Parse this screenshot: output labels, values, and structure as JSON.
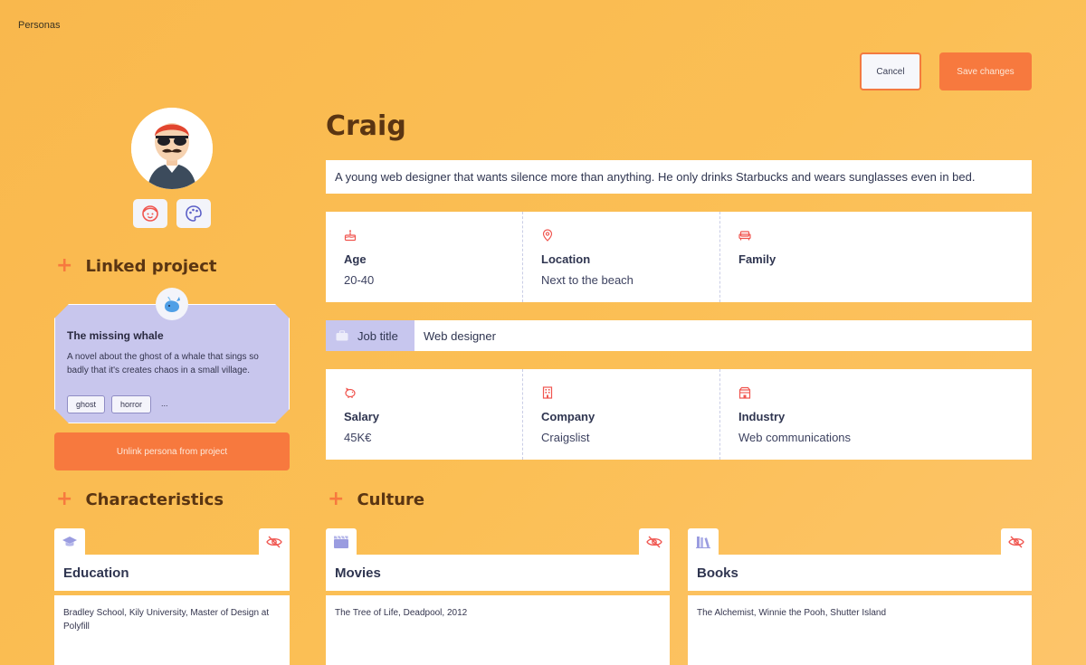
{
  "breadcrumb": "Personas",
  "actions": {
    "cancel": "Cancel",
    "save": "Save changes"
  },
  "persona": {
    "name": "Craig",
    "description": "A young web designer that wants silence more than anything. He only drinks Starbucks and wears sunglasses even in bed."
  },
  "linked_project": {
    "heading": "Linked project",
    "title": "The missing whale",
    "description": "A novel about the ghost of a whale that sings so badly that it's creates chaos in a small village.",
    "tags": [
      "ghost",
      "horror"
    ],
    "more": "...",
    "unlink_label": "Unlink persona from project"
  },
  "info_row_1": [
    {
      "icon": "cake-icon",
      "label": "Age",
      "value": "20-40"
    },
    {
      "icon": "location-pin-icon",
      "label": "Location",
      "value": "Next to the beach"
    },
    {
      "icon": "sofa-icon",
      "label": "Family",
      "value": ""
    }
  ],
  "job": {
    "label": "Job title",
    "value": "Web designer"
  },
  "info_row_2": [
    {
      "icon": "piggy-bank-icon",
      "label": "Salary",
      "value": "45K€"
    },
    {
      "icon": "building-icon",
      "label": "Company",
      "value": "Craigslist"
    },
    {
      "icon": "factory-icon",
      "label": "Industry",
      "value": "Web communications"
    }
  ],
  "characteristics": {
    "heading": "Characteristics",
    "cards": [
      {
        "icon": "graduation-cap-icon",
        "title": "Education",
        "body": "Bradley School, Kily University, Master of Design at Polyfill"
      }
    ]
  },
  "culture": {
    "heading": "Culture",
    "cards": [
      {
        "icon": "clapperboard-icon",
        "title": "Movies",
        "body": "The Tree of Life, Deadpool, 2012"
      },
      {
        "icon": "books-icon",
        "title": "Books",
        "body": "The Alchemist, Winnie the Pooh, Shutter Island"
      }
    ]
  },
  "colors": {
    "accent": "#f7793e",
    "heading": "#5a3512",
    "lavender": "#c7c6ee",
    "icon_red": "#f0554f"
  }
}
